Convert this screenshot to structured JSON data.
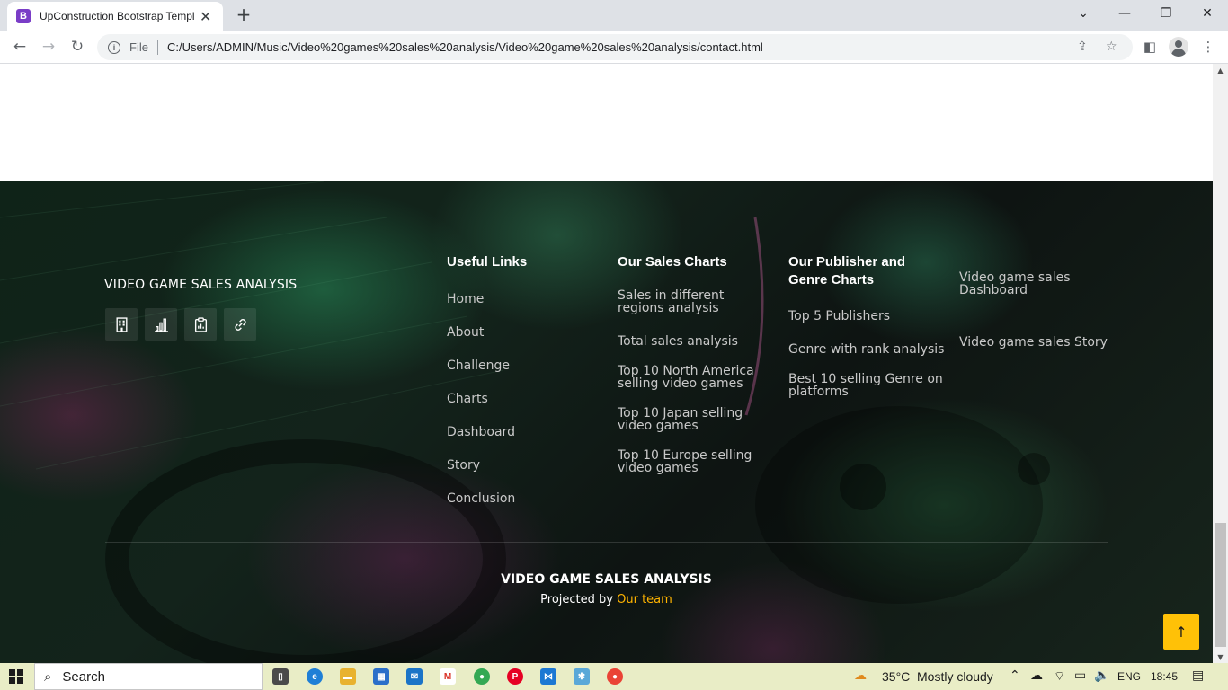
{
  "browser": {
    "tab_title": "UpConstruction Bootstrap Templ",
    "tab_favicon": "B",
    "tab_close": "✕",
    "new_tab": "+",
    "url_scheme": "File",
    "url": "C:/Users/ADMIN/Music/Video%20games%20sales%20analysis/Video%20game%20sales%20analysis/contact.html"
  },
  "footer": {
    "brand": "VIDEO GAME SALES ANALYSIS",
    "social_icons": [
      "building-icon",
      "bar-chart-icon",
      "clipboard-data-icon",
      "link-icon"
    ],
    "useful_links": {
      "heading": "Useful Links",
      "items": [
        "Home",
        "About",
        "Challenge",
        "Charts",
        "Dashboard",
        "Story",
        "Conclusion"
      ]
    },
    "sales_charts": {
      "heading": "Our Sales Charts",
      "items": [
        "Sales in different regions analysis",
        "Total sales analysis",
        "Top 10 North America selling video games",
        "Top 10 Japan selling video games",
        "Top 10 Europe selling video games"
      ]
    },
    "publisher_charts": {
      "heading": "Our Publisher and Genre Charts",
      "items": [
        "Top 5 Publishers",
        "Genre with rank analysis",
        "Best 10 selling Genre on platforms"
      ]
    },
    "dashboard_links": {
      "items": [
        "Video game sales Dashboard",
        "Video game sales Story"
      ]
    },
    "copyright": "VIDEO GAME SALES ANALYSIS",
    "projected_by": "Projected by",
    "team_link": "Our team",
    "back_to_top": "↑"
  },
  "taskbar": {
    "search_label": "Search",
    "weather_temp": "35°C",
    "weather_text": "Mostly cloudy",
    "language": "ENG",
    "time": "18:45"
  },
  "colors": {
    "accent": "#ffc107",
    "team_link": "#ffb400",
    "footer_link": "#c9c9c9",
    "taskbar": "#e9edc6"
  }
}
